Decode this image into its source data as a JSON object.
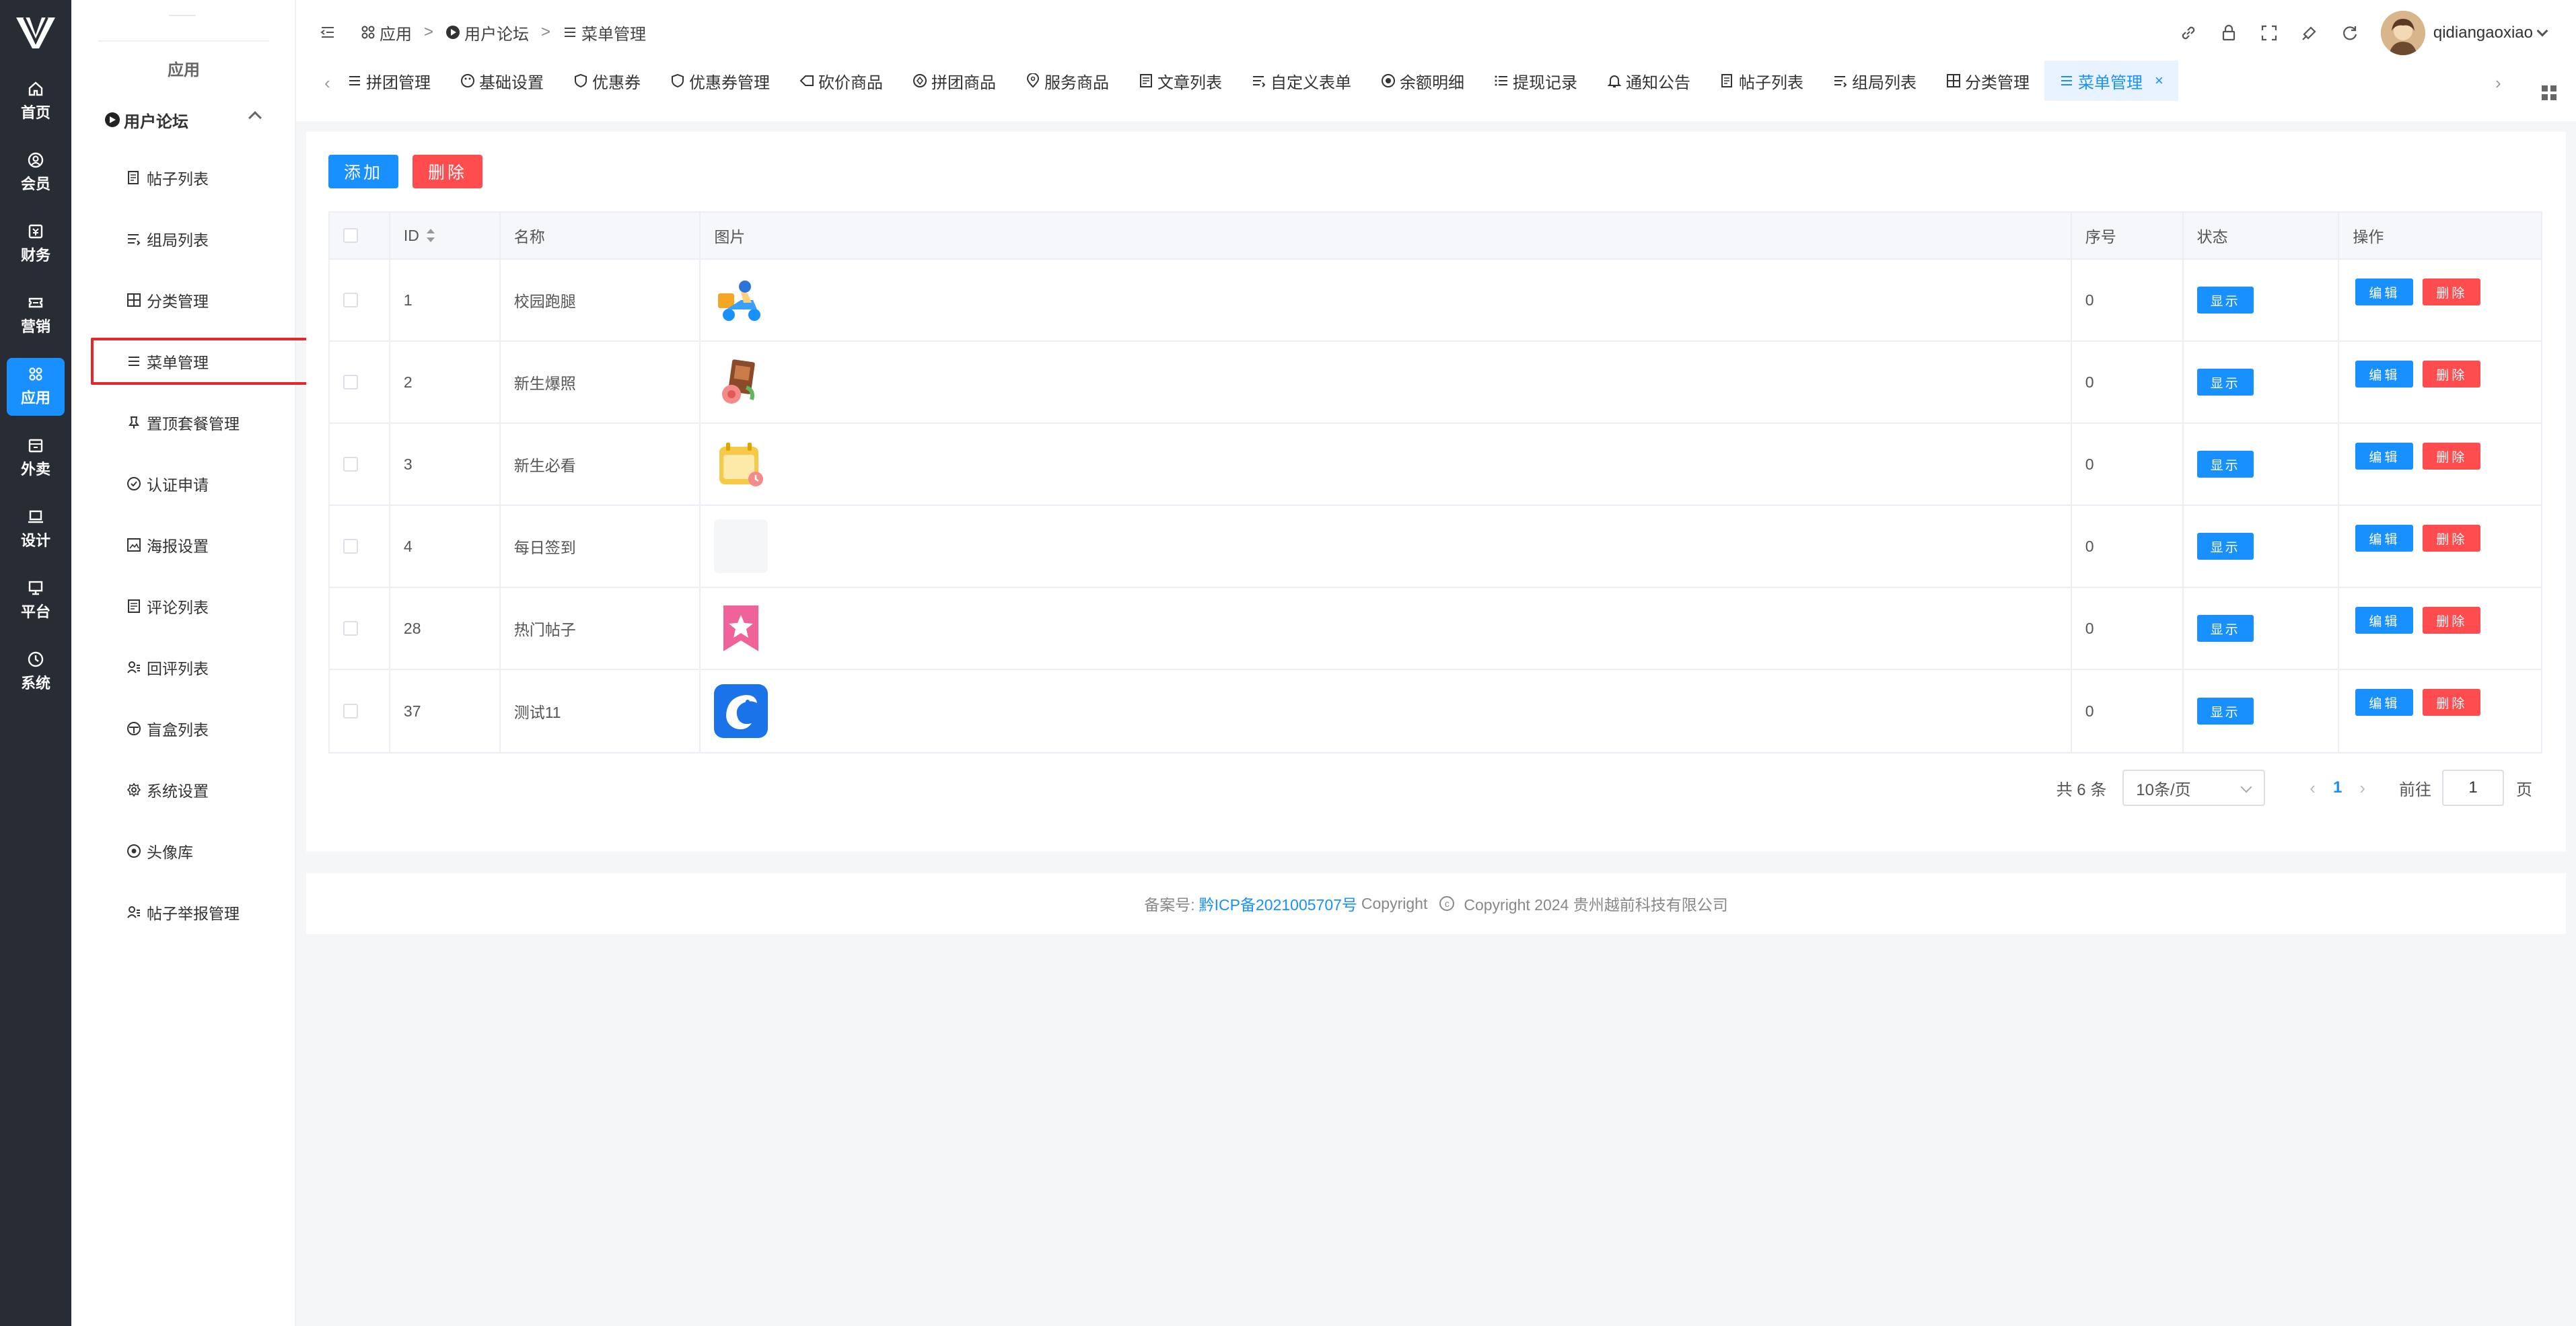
{
  "primary_nav": [
    {
      "label": "首页",
      "icon": "home-icon"
    },
    {
      "label": "会员",
      "icon": "user-icon"
    },
    {
      "label": "财务",
      "icon": "finance-icon"
    },
    {
      "label": "营销",
      "icon": "ticket-icon"
    },
    {
      "label": "应用",
      "icon": "apps-icon",
      "active": true
    },
    {
      "label": "外卖",
      "icon": "store-icon"
    },
    {
      "label": "设计",
      "icon": "laptop-icon"
    },
    {
      "label": "平台",
      "icon": "monitor-icon"
    },
    {
      "label": "系统",
      "icon": "clock-icon"
    }
  ],
  "secondary_nav": {
    "title": "应用",
    "group_label": "用户论坛",
    "items": [
      {
        "label": "帖子列表",
        "icon": "document-icon"
      },
      {
        "label": "组局列表",
        "icon": "list-icon"
      },
      {
        "label": "分类管理",
        "icon": "grid-icon"
      },
      {
        "label": "菜单管理",
        "icon": "menu-icon",
        "active": true
      },
      {
        "label": "置顶套餐管理",
        "icon": "pin-icon"
      },
      {
        "label": "认证申请",
        "icon": "check-circle-icon"
      },
      {
        "label": "海报设置",
        "icon": "image-icon"
      },
      {
        "label": "评论列表",
        "icon": "comment-list-icon"
      },
      {
        "label": "回评列表",
        "icon": "user-list-icon"
      },
      {
        "label": "盲盒列表",
        "icon": "box-icon"
      },
      {
        "label": "系统设置",
        "icon": "gear-icon"
      },
      {
        "label": "头像库",
        "icon": "avatar-icon"
      },
      {
        "label": "帖子举报管理",
        "icon": "report-icon"
      }
    ]
  },
  "breadcrumb": {
    "items": [
      "应用",
      "用户论坛",
      "菜单管理"
    ],
    "separator": ">"
  },
  "header": {
    "username": "qidiangaoxiao"
  },
  "tabs": [
    {
      "label": "拼团管理"
    },
    {
      "label": "基础设置"
    },
    {
      "label": "优惠券"
    },
    {
      "label": "优惠券管理"
    },
    {
      "label": "砍价商品"
    },
    {
      "label": "拼团商品"
    },
    {
      "label": "服务商品"
    },
    {
      "label": "文章列表"
    },
    {
      "label": "自定义表单"
    },
    {
      "label": "余额明细"
    },
    {
      "label": "提现记录"
    },
    {
      "label": "通知公告"
    },
    {
      "label": "帖子列表"
    },
    {
      "label": "组局列表"
    },
    {
      "label": "分类管理"
    },
    {
      "label": "菜单管理",
      "active": true,
      "close": "×"
    }
  ],
  "toolbar": {
    "add_label": "添加",
    "delete_label": "删除"
  },
  "table": {
    "headers": {
      "id": "ID",
      "name": "名称",
      "image": "图片",
      "order": "序号",
      "status": "状态",
      "ops": "操作"
    },
    "rows": [
      {
        "id": "1",
        "name": "校园跑腿",
        "image": "delivery-rider-icon",
        "order": "0",
        "status": "显示"
      },
      {
        "id": "2",
        "name": "新生爆照",
        "image": "photo-flower-icon",
        "order": "0",
        "status": "显示"
      },
      {
        "id": "3",
        "name": "新生必看",
        "image": "class-calendar-icon",
        "order": "0",
        "status": "显示"
      },
      {
        "id": "4",
        "name": "每日签到",
        "image": "",
        "order": "0",
        "status": "显示"
      },
      {
        "id": "28",
        "name": "热门帖子",
        "image": "star-bookmark-icon",
        "order": "0",
        "status": "显示"
      },
      {
        "id": "37",
        "name": "测试11",
        "image": "dolphin-logo-icon",
        "order": "0",
        "status": "显示"
      }
    ],
    "edit_label": "编辑",
    "delete_label": "删除"
  },
  "pagination": {
    "total_text": "共 6 条",
    "page_size": "10条/页",
    "current_page": "1",
    "goto_label": "前往",
    "goto_value": "1",
    "page_suffix": "页",
    "prev": "‹",
    "next": "›"
  },
  "footer": {
    "icp_label": "备案号:",
    "icp_link": "黔ICP备2021005707号",
    "copyright_word": "Copyright",
    "copyright_text": "Copyright 2024 贵州越前科技有限公司"
  },
  "colors": {
    "primary": "#1890ff",
    "danger": "#ff4d4f",
    "nav_dark": "#282c34",
    "highlight": "#e5262b"
  }
}
